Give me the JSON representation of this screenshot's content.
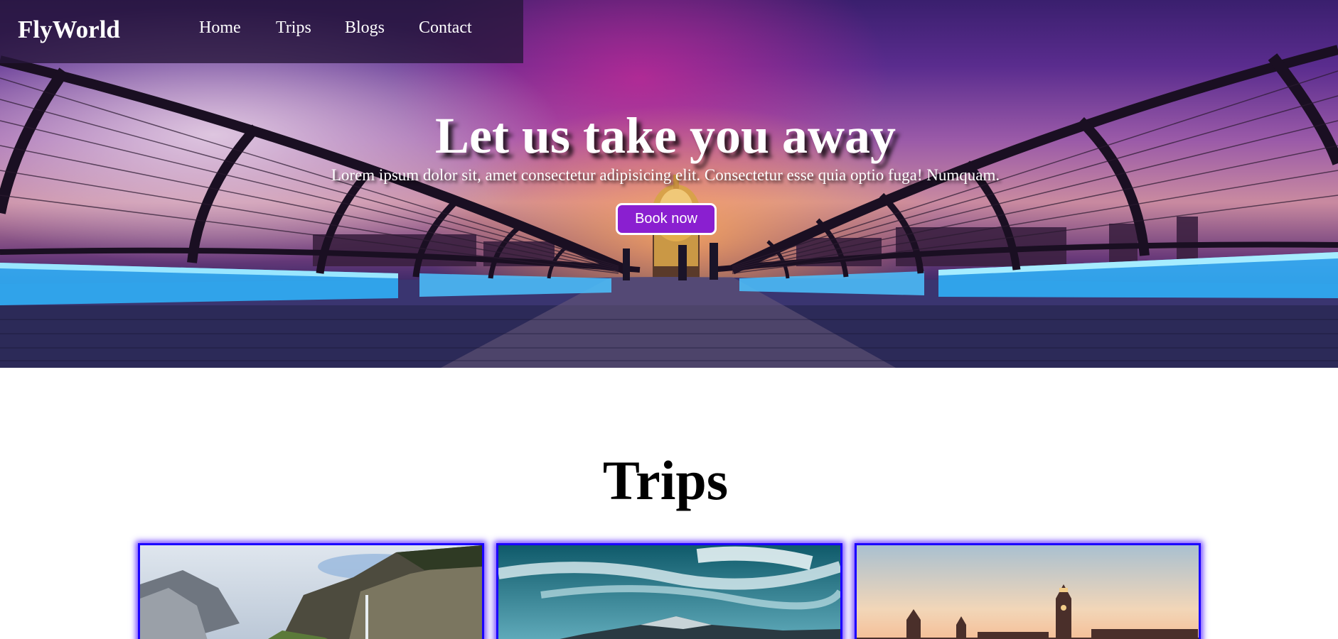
{
  "nav": {
    "brand": "FlyWorld",
    "links": [
      "Home",
      "Trips",
      "Blogs",
      "Contact"
    ]
  },
  "hero": {
    "title": "Let us take you away",
    "subtitle": "Lorem ipsum dolor sit, amet consectetur adipisicing elit. Consectetur esse quia optio fuga! Numquam.",
    "button_label": "Book now"
  },
  "trips": {
    "heading": "Trips"
  },
  "colors": {
    "accent": "#8a1fd0",
    "card_border": "#1a00ff",
    "nav_bg": "#26163a"
  }
}
